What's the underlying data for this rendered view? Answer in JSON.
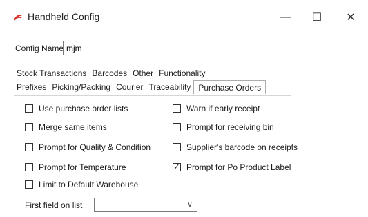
{
  "window": {
    "title": "Handheld Config",
    "minimize_glyph": "—",
    "maximize_glyph": "☐",
    "close_glyph": "✕",
    "accent": "#d9342b"
  },
  "form": {
    "config_name_label": "Config Name",
    "config_name_value": "mjm"
  },
  "tabs": {
    "row1": [
      "Stock Transactions",
      "Barcodes",
      "Other",
      "Functionality"
    ],
    "row2": [
      "Prefixes",
      "Picking/Packing",
      "Courier",
      "Traceability",
      "Purchase Orders"
    ],
    "active": "Purchase Orders"
  },
  "options": {
    "left": [
      {
        "label": "Use purchase order lists",
        "checked": false
      },
      {
        "label": "Merge same items",
        "checked": false
      },
      {
        "label": "Prompt for Quality & Condition",
        "checked": false
      },
      {
        "label": "Prompt for Temperature",
        "checked": false
      },
      {
        "label": "Limit to Default Warehouse",
        "checked": false
      }
    ],
    "right": [
      {
        "label": "Warn if early receipt",
        "checked": false
      },
      {
        "label": "Prompt for receiving bin",
        "checked": false
      },
      {
        "label": "Supplier's barcode on receipts",
        "checked": false
      },
      {
        "label": "Prompt for Po Product Label",
        "checked": true
      }
    ]
  },
  "first_field": {
    "label": "First field on list",
    "value": ""
  }
}
